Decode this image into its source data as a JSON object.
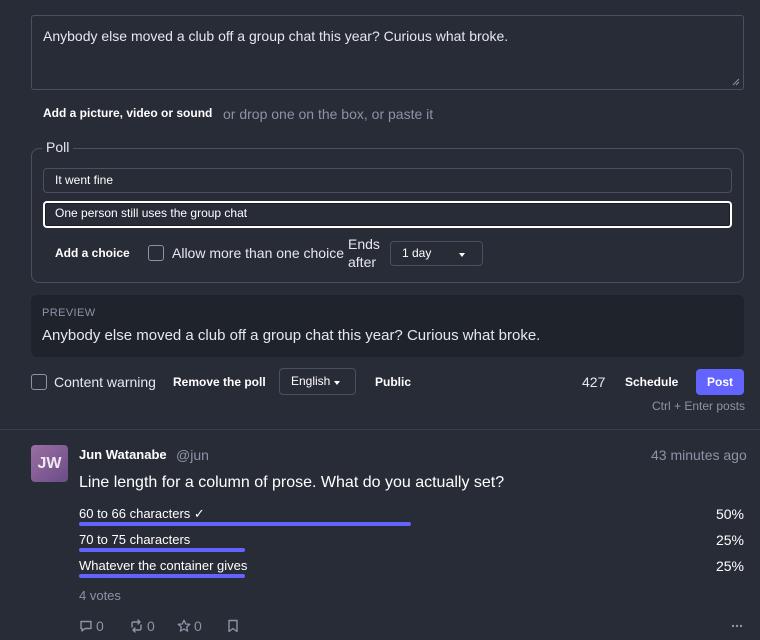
{
  "composer": {
    "text": "Anybody else moved a club off a group chat this year? Curious what broke.",
    "add_media_label": "Add a picture, video or sound",
    "drop_hint": "or drop one on the box, or paste it"
  },
  "poll": {
    "legend": "Poll",
    "choices": [
      "It went fine",
      "One person still uses the group chat"
    ],
    "add_choice_label": "Add a choice",
    "multiple_label": "Allow more than one choice",
    "ends_label": "Ends after",
    "duration": "1 day"
  },
  "preview": {
    "label": "PREVIEW",
    "text": "Anybody else moved a club off a group chat this year? Curious what broke."
  },
  "toolbar": {
    "content_warning_label": "Content warning",
    "remove_poll_label": "Remove the poll",
    "language": "English",
    "visibility": "Public",
    "char_count": "427",
    "schedule_label": "Schedule",
    "post_label": "Post",
    "shortcut_hint": "Ctrl + Enter posts"
  },
  "status": {
    "avatar_initials": "JW",
    "display_name": "Jun Watanabe",
    "handle": "@jun",
    "time": "43 minutes ago",
    "text": "Line length for a column of prose. What do you actually set?",
    "options": [
      {
        "label": "60 to 66 characters ✓",
        "percent": "50%",
        "fraction": 0.5
      },
      {
        "label": "70 to 75 characters",
        "percent": "25%",
        "fraction": 0.25
      },
      {
        "label": "Whatever the container gives",
        "percent": "25%",
        "fraction": 0.25
      }
    ],
    "votes": "4 votes",
    "actions": {
      "replies": "0",
      "boosts": "0",
      "favourites": "0"
    }
  },
  "colors": {
    "accent": "#6364ff",
    "background": "#282c37",
    "muted_text": "#8d93a6"
  }
}
